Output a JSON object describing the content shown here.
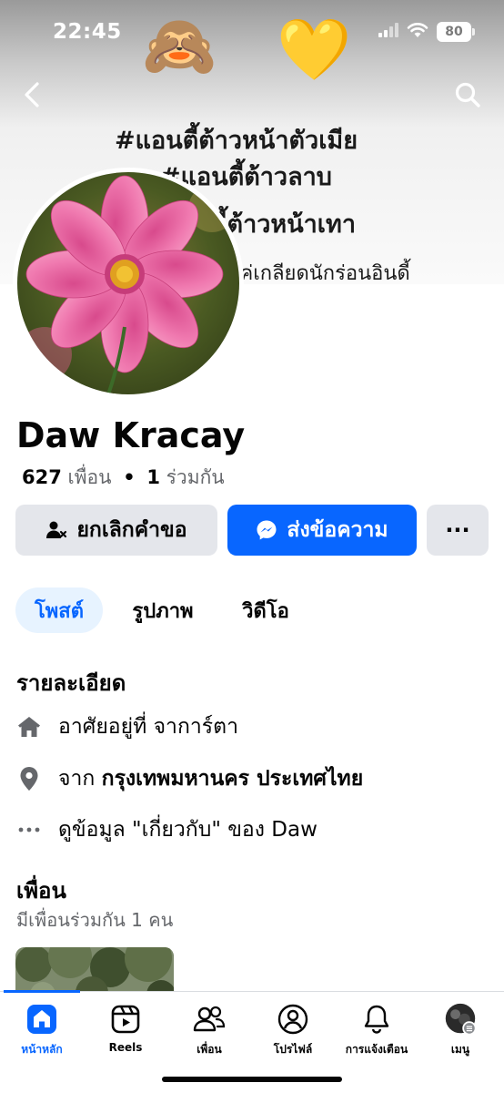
{
  "status_bar": {
    "time": "22:45",
    "battery": "80",
    "icons": [
      "signal-icon",
      "wifi-icon",
      "battery-icon"
    ]
  },
  "cover": {
    "emoji_left": "🙈",
    "emoji_right": "💛",
    "lines": [
      "#แอนตี้ต้าวหน้าตัวเมีย",
      "#แอนตี้ต้าวลาบ",
      "ตี้ต้าวหน้าเทา",
      "เค่เกลียดนักร่อนอินดี้"
    ]
  },
  "profile": {
    "name": "Daw Kracay",
    "friends_count": "627",
    "friends_label": "เพื่อน",
    "separator": "•",
    "mutual_count": "1",
    "mutual_label": "ร่วมกัน"
  },
  "actions": {
    "cancel_request": "ยกเลิกคำขอ",
    "send_message": "ส่งข้อความ",
    "more": "···"
  },
  "tabs": [
    "โพสต์",
    "รูปภาพ",
    "วิดีโอ"
  ],
  "details": {
    "title": "รายละเอียด",
    "lives_in": "อาศัยอยู่ที่ จาการ์ตา",
    "from_prefix": "จาก",
    "from_place": "กรุงเทพมหานคร ประเทศไทย",
    "about_link": "ดูข้อมูล \"เกี่ยวกับ\" ของ Daw"
  },
  "friends": {
    "title": "เพื่อน",
    "mutual": "มีเพื่อนร่วมกัน 1 คน"
  },
  "nav": {
    "home": "หน้าหลัก",
    "reels": "Reels",
    "friends": "เพื่อน",
    "profile": "โปรไฟล์",
    "notifications": "การแจ้งเตือน",
    "menu": "เมนู"
  },
  "colors": {
    "accent": "#0866ff",
    "button_gray": "#e4e6eb",
    "tab_active_bg": "#e7f3ff",
    "secondary_text": "#65676b"
  }
}
